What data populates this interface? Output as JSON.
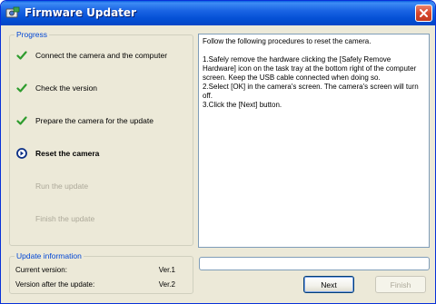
{
  "window": {
    "title": "Firmware Updater"
  },
  "progress": {
    "title": "Progress",
    "steps": [
      {
        "label": "Connect the camera and the computer",
        "state": "done"
      },
      {
        "label": "Check the version",
        "state": "done"
      },
      {
        "label": "Prepare the camera for the update",
        "state": "done"
      },
      {
        "label": "Reset the camera",
        "state": "current"
      },
      {
        "label": "Run the update",
        "state": "pending"
      },
      {
        "label": "Finish the update",
        "state": "pending"
      }
    ]
  },
  "update_info": {
    "title": "Update information",
    "current_label": "Current version:",
    "current_value": "Ver.1",
    "after_label": "Version after the update:",
    "after_value": "Ver.2"
  },
  "instructions": {
    "text": "Follow the following procedures to reset the camera.\n\n1.Safely remove the hardware clicking the [Safely Remove Hardware] icon on the task tray at the bottom right of the computer screen. Keep the USB cable connected when doing so.\n2.Select [OK] in the camera's screen. The camera's screen will turn off.\n3.Click the [Next] button."
  },
  "progress_bar": {
    "fraction": 0
  },
  "buttons": {
    "next_label": "Next",
    "finish_label": "Finish"
  },
  "colors": {
    "titlebar": "#0551d6",
    "group_title": "#0046d5",
    "check": "#2e9c2e",
    "current_marker": "#0b2f86",
    "disabled_text": "#aca899"
  },
  "icons": {
    "done": "checkmark-icon",
    "current": "arrow-right-circle-icon",
    "close": "close-icon",
    "app": "firmware-updater-app-icon"
  }
}
